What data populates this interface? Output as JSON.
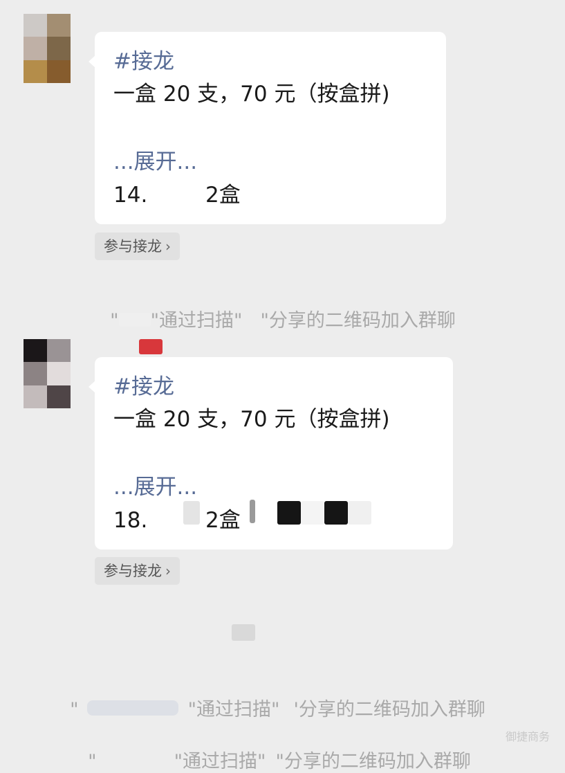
{
  "messages": [
    {
      "tag": "#接龙",
      "line1": "一盒 20 支，70 元（按盒拼)",
      "expand": "...展开...",
      "entry_num": "14.",
      "entry_qty": "2盒"
    },
    {
      "tag": "#接龙",
      "line1": "一盒 20 支，70 元（按盒拼)",
      "expand": "...展开...",
      "entry_num": "18.",
      "entry_qty": "2盒"
    }
  ],
  "join_button": {
    "label": "参与接龙",
    "chevron": "›"
  },
  "system_notices": [
    {
      "open_quote": "\"",
      "via": "\"通过扫描\"",
      "rest": "\"分享的二维码加入群聊"
    },
    {
      "open_quote": "\"",
      "via": "\"通过扫描\"",
      "rest": "'分享的二维码加入群聊"
    },
    {
      "open_quote": "\"",
      "via": "\"通过扫描\"",
      "rest": "\"分享的二维码加入群聊"
    }
  ],
  "watermark": "御捷商务",
  "colors": {
    "background": "#ededed",
    "link": "#576b95",
    "system_text": "#a9a9a9"
  }
}
